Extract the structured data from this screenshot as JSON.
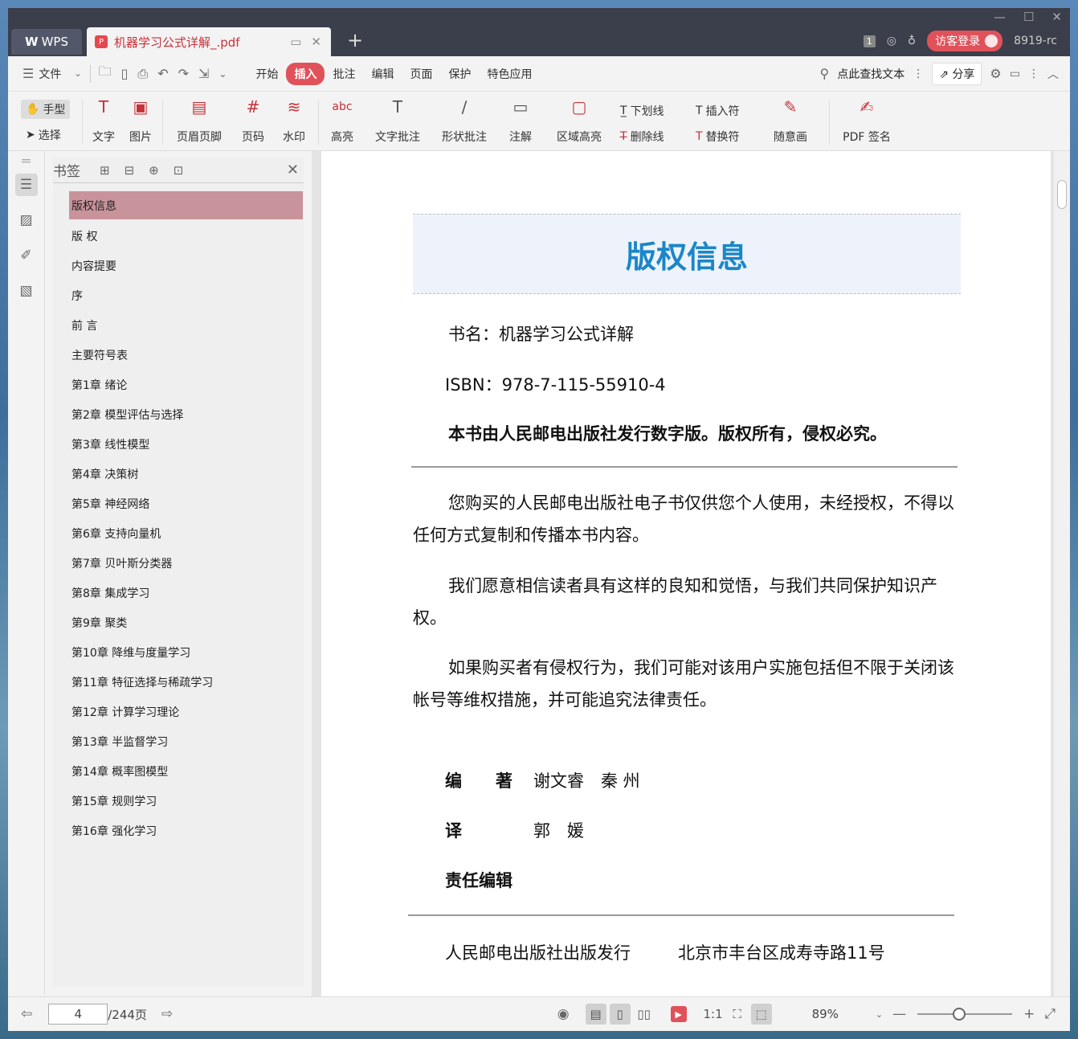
{
  "window": {
    "app_tab": "WPS",
    "doc_tab": "机器学习公式详解_.pdf",
    "new_tab": "+",
    "page_badge": "1",
    "login_label": "访客登录",
    "build": "8919-rc"
  },
  "menu": {
    "file": "文件",
    "items": [
      "开始",
      "插入",
      "批注",
      "编辑",
      "页面",
      "保护",
      "特色应用"
    ],
    "active": "插入",
    "search": "点此查找文本",
    "share": "分享"
  },
  "ribbon": {
    "hand": "手型",
    "select": "选择",
    "text": "文字",
    "image": "图片",
    "header_footer": "页眉页脚",
    "page_number": "页码",
    "watermark": "水印",
    "highlight": "高亮",
    "text_comment": "文字批注",
    "shape_comment": "形状批注",
    "annotation": "注解",
    "area_highlight": "区域高亮",
    "underline": "下划线",
    "strikethrough": "删除线",
    "insert_mark": "插入符",
    "replace_mark": "替换符",
    "freehand": "随意画",
    "pdf_sign": "PDF 签名"
  },
  "bookmarks": {
    "title": "书签",
    "items": [
      "版权信息",
      "版 权",
      "内容提要",
      "序",
      "前 言",
      "主要符号表",
      "第1章 绪论",
      "第2章 模型评估与选择",
      "第3章 线性模型",
      "第4章 决策树",
      "第5章 神经网络",
      "第6章 支持向量机",
      "第7章 贝叶斯分类器",
      "第8章 集成学习",
      "第9章 聚类",
      "第10章 降维与度量学习",
      "第11章 特征选择与稀疏学习",
      "第12章 计算学习理论",
      "第13章 半监督学习",
      "第14章 概率图模型",
      "第15章 规则学习",
      "第16章 强化学习"
    ]
  },
  "page": {
    "heading": "版权信息",
    "book_name": "书名：机器学习公式详解",
    "isbn": "ISBN：978-7-115-55910-4",
    "rights": "本书由人民邮电出版社发行数字版。版权所有，侵权必究。",
    "para1": "您购买的人民邮电出版社电子书仅供您个人使用，未经授权，不得以任何方式复制和传播本书内容。",
    "para2": "我们愿意相信读者具有这样的良知和觉悟，与我们共同保护知识产权。",
    "para3": "如果购买者有侵权行为，我们可能对该用户实施包括但不限于关闭该帐号等维权措施，并可能追究法律责任。",
    "author_label": "编　　著",
    "authors": "谢文睿　秦 州",
    "translator_label": "译",
    "translator": "郭　媛",
    "editor_label": "责任编辑",
    "publisher": "人民邮电出版社出版发行",
    "address": "北京市丰台区成寿寺路11号"
  },
  "status": {
    "current_page": "4",
    "total": "/244页",
    "zoom": "89%"
  },
  "colors": {
    "accent": "#e0525a",
    "heading_blue": "#1b86c8",
    "titlebar": "#3b3e4b",
    "bookmark_selected": "#c9939b"
  }
}
